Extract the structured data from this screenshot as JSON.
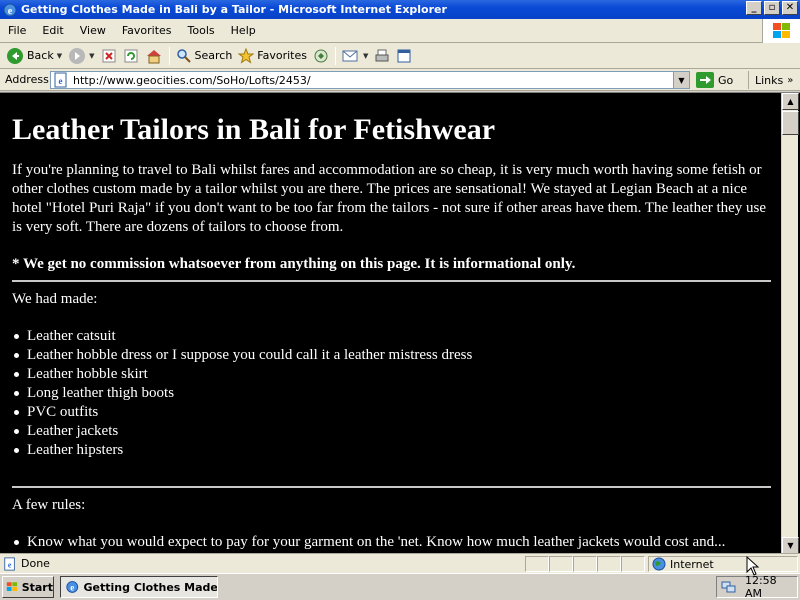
{
  "window": {
    "title": "Getting Clothes Made in Bali by a Tailor - Microsoft Internet Explorer",
    "minimize_glyph": "_",
    "maximize_glyph": "▫",
    "close_glyph": "✕"
  },
  "menu": {
    "items": [
      "File",
      "Edit",
      "View",
      "Favorites",
      "Tools",
      "Help"
    ]
  },
  "toolbar": {
    "back_label": "Back",
    "search_label": "Search",
    "favorites_label": "Favorites"
  },
  "address": {
    "label": "Address",
    "url": "http://www.geocities.com/SoHo/Lofts/2453/",
    "go_label": "Go",
    "links_label": "Links"
  },
  "page": {
    "heading": "Leather Tailors in Bali for Fetishwear",
    "intro": "If you're planning to travel to Bali whilst fares and accommodation are so cheap, it is very much worth having some fetish or other clothes custom made by a tailor whilst you are there. The prices are sensational! We stayed at Legian Beach at a nice hotel \"Hotel Puri Raja\" if you don't want to be too far from the tailors - not sure if other areas have them. The leather they use is very soft. There are dozens of tailors to choose from.",
    "disclaimer": "* We get no commission whatsoever from anything on this page. It is informational only.",
    "we_had_made": "We had made:",
    "items": [
      "Leather catsuit",
      "Leather hobble dress or I suppose you could call it a leather mistress dress",
      "Leather hobble skirt",
      "Long leather thigh boots",
      "PVC outfits",
      "Leather jackets",
      "Leather hipsters"
    ],
    "rules_heading": "A few rules:",
    "rules": [
      "Know what you would expect to pay for your garment on the 'net. Know how much leather jackets would cost and..."
    ]
  },
  "status": {
    "text": "Done",
    "zone": "Internet"
  },
  "taskbar": {
    "start_label": "Start",
    "task_label": "Getting Clothes Made...",
    "clock": "12:58 AM"
  }
}
